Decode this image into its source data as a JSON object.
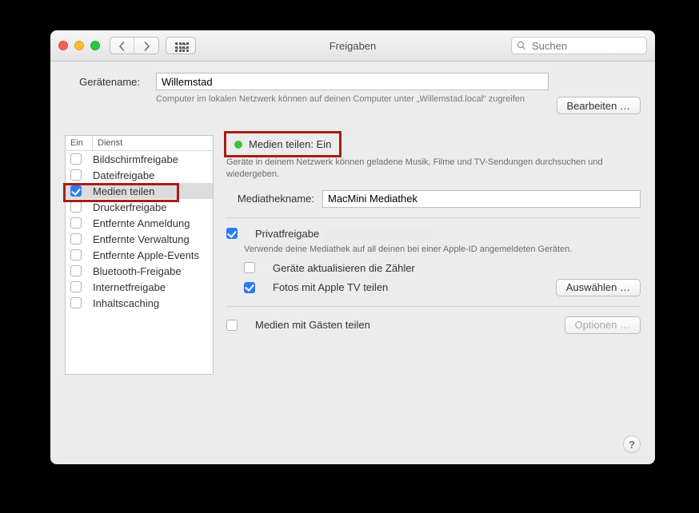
{
  "window": {
    "title": "Freigaben"
  },
  "search": {
    "placeholder": "Suchen"
  },
  "device": {
    "label": "Gerätename:",
    "value": "Willemstad",
    "hint": "Computer im lokalen Netzwerk können auf deinen Computer unter „Willemstad.local“ zugreifen",
    "edit_button": "Bearbeiten …"
  },
  "svc_header": {
    "col1": "Ein",
    "col2": "Dienst"
  },
  "services": [
    {
      "label": "Bildschirmfreigabe",
      "checked": false,
      "selected": false
    },
    {
      "label": "Dateifreigabe",
      "checked": false,
      "selected": false
    },
    {
      "label": "Medien teilen",
      "checked": true,
      "selected": true
    },
    {
      "label": "Druckerfreigabe",
      "checked": false,
      "selected": false
    },
    {
      "label": "Entfernte Anmeldung",
      "checked": false,
      "selected": false
    },
    {
      "label": "Entfernte Verwaltung",
      "checked": false,
      "selected": false
    },
    {
      "label": "Entfernte Apple-Events",
      "checked": false,
      "selected": false
    },
    {
      "label": "Bluetooth-Freigabe",
      "checked": false,
      "selected": false
    },
    {
      "label": "Internetfreigabe",
      "checked": false,
      "selected": false
    },
    {
      "label": "Inhaltscaching",
      "checked": false,
      "selected": false
    }
  ],
  "status": {
    "text": "Medien teilen: Ein"
  },
  "status_sub": "Geräte in deinem Netzwerk können geladene Musik, Filme und TV-Sendungen durchsuchen und wiedergeben.",
  "library": {
    "label": "Mediathekname:",
    "value": "MacMini Mediathek"
  },
  "home_sharing": {
    "label": "Privatfreigabe",
    "note": "Verwende deine Mediathek auf all deinen bei einer Apple-ID angemeldeten Geräten.",
    "update_counts": "Geräte aktualisieren die Zähler",
    "share_photos": "Fotos mit Apple TV teilen",
    "choose_button": "Auswählen …"
  },
  "guests": {
    "label": "Medien mit Gästen teilen",
    "options_button": "Optionen …"
  },
  "help_glyph": "?"
}
